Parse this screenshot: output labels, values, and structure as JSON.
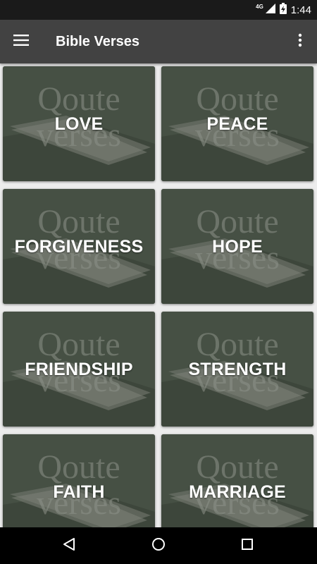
{
  "status_bar": {
    "network": "4G",
    "time": "1:44"
  },
  "app_bar": {
    "title": "Bible Verses"
  },
  "cards": [
    {
      "label": "LOVE"
    },
    {
      "label": "PEACE"
    },
    {
      "label": "FORGIVENESS"
    },
    {
      "label": "HOPE"
    },
    {
      "label": "FRIENDSHIP"
    },
    {
      "label": "STRENGTH"
    },
    {
      "label": "FAITH"
    },
    {
      "label": "MARRIAGE"
    }
  ],
  "card_background": {
    "watermark_line1": "Qoute",
    "watermark_line2": "verses"
  },
  "icons": {
    "menu": "hamburger-menu-icon",
    "more": "more-vertical-icon",
    "back": "back-triangle-icon",
    "home": "home-circle-icon",
    "recents": "recents-square-icon"
  },
  "colors": {
    "app_bar": "#424242",
    "status_bar": "#1a1a1a",
    "background": "#ececec",
    "card_tint": "#454f43"
  }
}
